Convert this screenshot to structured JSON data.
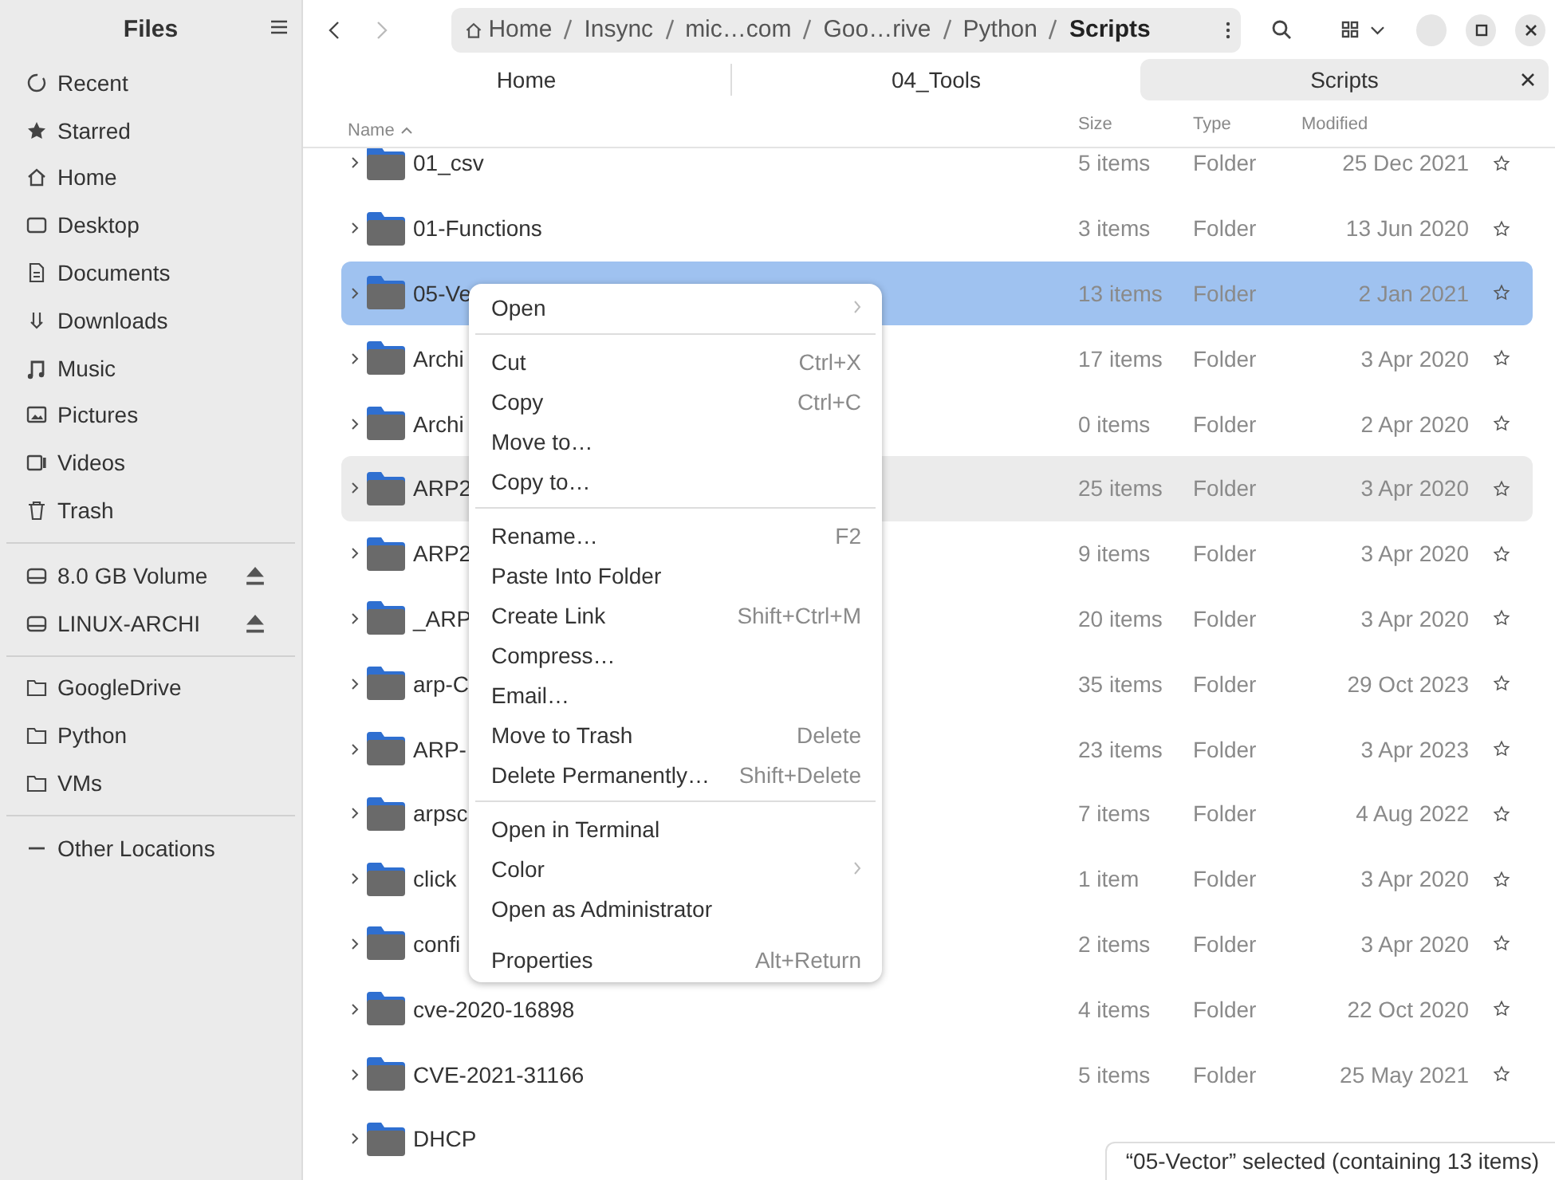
{
  "sidebar": {
    "title": "Files",
    "items": [
      {
        "label": "Recent",
        "kind": "place"
      },
      {
        "label": "Starred",
        "kind": "place"
      },
      {
        "label": "Home",
        "kind": "place"
      },
      {
        "label": "Desktop",
        "kind": "place"
      },
      {
        "label": "Documents",
        "kind": "place"
      },
      {
        "label": "Downloads",
        "kind": "place"
      },
      {
        "label": "Music",
        "kind": "place"
      },
      {
        "label": "Pictures",
        "kind": "place"
      },
      {
        "label": "Videos",
        "kind": "place"
      },
      {
        "label": "Trash",
        "kind": "place"
      },
      {
        "label": "8.0 GB Volume",
        "kind": "drive"
      },
      {
        "label": "LINUX-ARCHI",
        "kind": "drive"
      },
      {
        "label": "GoogleDrive",
        "kind": "bookmark"
      },
      {
        "label": "Python",
        "kind": "bookmark"
      },
      {
        "label": "VMs",
        "kind": "bookmark"
      },
      {
        "label": "Other Locations",
        "kind": "other"
      }
    ]
  },
  "path_bar": {
    "segments": [
      {
        "label": "Home",
        "selected": false
      },
      {
        "label": "Insync",
        "selected": false
      },
      {
        "label": "mic…com",
        "selected": false
      },
      {
        "label": "Goo…rive",
        "selected": false
      },
      {
        "label": "Python",
        "selected": false
      },
      {
        "label": "Scripts",
        "selected": true
      }
    ]
  },
  "tabs": [
    {
      "label": "Home",
      "selected": false
    },
    {
      "label": "04_Tools",
      "selected": false
    },
    {
      "label": "Scripts",
      "selected": true
    }
  ],
  "table": {
    "columns": [
      "Name",
      "Size",
      "Type",
      "Modified"
    ],
    "rows": [
      {
        "name": "01_csv",
        "size": "5 items",
        "type": "Folder",
        "modified": "25 Dec 2021",
        "selected": false,
        "hovered": false
      },
      {
        "name": "01-Functions",
        "size": "3 items",
        "type": "Folder",
        "modified": "13 Jun 2020",
        "selected": false,
        "hovered": false
      },
      {
        "name": "05-Ve",
        "size": "13 items",
        "type": "Folder",
        "modified": "2 Jan 2021",
        "selected": true,
        "hovered": false
      },
      {
        "name": "Archi",
        "size": "17 items",
        "type": "Folder",
        "modified": "3 Apr 2020",
        "selected": false,
        "hovered": false
      },
      {
        "name": "Archi",
        "size": "0 items",
        "type": "Folder",
        "modified": "2 Apr 2020",
        "selected": false,
        "hovered": false
      },
      {
        "name": "ARP2",
        "size": "25 items",
        "type": "Folder",
        "modified": "3 Apr 2020",
        "selected": false,
        "hovered": true
      },
      {
        "name": "ARP2",
        "size": "9 items",
        "type": "Folder",
        "modified": "3 Apr 2020",
        "selected": false,
        "hovered": false
      },
      {
        "name": "_ARP",
        "size": "20 items",
        "type": "Folder",
        "modified": "3 Apr 2020",
        "selected": false,
        "hovered": false
      },
      {
        "name": "arp-C",
        "size": "35 items",
        "type": "Folder",
        "modified": "29 Oct 2023",
        "selected": false,
        "hovered": false
      },
      {
        "name": "ARP-",
        "size": "23 items",
        "type": "Folder",
        "modified": "3 Apr 2023",
        "selected": false,
        "hovered": false
      },
      {
        "name": "arpsc",
        "size": "7 items",
        "type": "Folder",
        "modified": "4 Aug 2022",
        "selected": false,
        "hovered": false
      },
      {
        "name": "click",
        "size": "1 item",
        "type": "Folder",
        "modified": "3 Apr 2020",
        "selected": false,
        "hovered": false
      },
      {
        "name": "confi",
        "size": "2 items",
        "type": "Folder",
        "modified": "3 Apr 2020",
        "selected": false,
        "hovered": false
      },
      {
        "name": "cve-2020-16898",
        "size": "4 items",
        "type": "Folder",
        "modified": "22 Oct 2020",
        "selected": false,
        "hovered": false
      },
      {
        "name": "CVE-2021-31166",
        "size": "5 items",
        "type": "Folder",
        "modified": "25 May 2021",
        "selected": false,
        "hovered": false
      },
      {
        "name": "DHCP",
        "selected": false,
        "hovered": false
      }
    ]
  },
  "context_menu": {
    "items": [
      {
        "kind": "submenu",
        "label": "Open"
      },
      {
        "kind": "separator"
      },
      {
        "kind": "item",
        "label": "Cut",
        "shortcut": "Ctrl+X"
      },
      {
        "kind": "item",
        "label": "Copy",
        "shortcut": "Ctrl+C"
      },
      {
        "kind": "item",
        "label": "Move to…"
      },
      {
        "kind": "item",
        "label": "Copy to…"
      },
      {
        "kind": "separator"
      },
      {
        "kind": "item",
        "label": "Rename…",
        "shortcut": "F2"
      },
      {
        "kind": "item",
        "label": "Paste Into Folder"
      },
      {
        "kind": "item",
        "label": "Create Link",
        "shortcut": "Shift+Ctrl+M"
      },
      {
        "kind": "item",
        "label": "Compress…"
      },
      {
        "kind": "item",
        "label": "Email…"
      },
      {
        "kind": "item",
        "label": "Move to Trash",
        "shortcut": "Delete"
      },
      {
        "kind": "item",
        "label": "Delete Permanently…",
        "shortcut": "Shift+Delete"
      },
      {
        "kind": "separator"
      },
      {
        "kind": "item",
        "label": "Open in Terminal"
      },
      {
        "kind": "submenu",
        "label": "Color"
      },
      {
        "kind": "item",
        "label": "Open as Administrator"
      },
      {
        "kind": "spacer"
      },
      {
        "kind": "item",
        "label": "Properties",
        "shortcut": "Alt+Return"
      }
    ]
  },
  "status_bar": "“05-Vector” selected (containing 13 items)"
}
